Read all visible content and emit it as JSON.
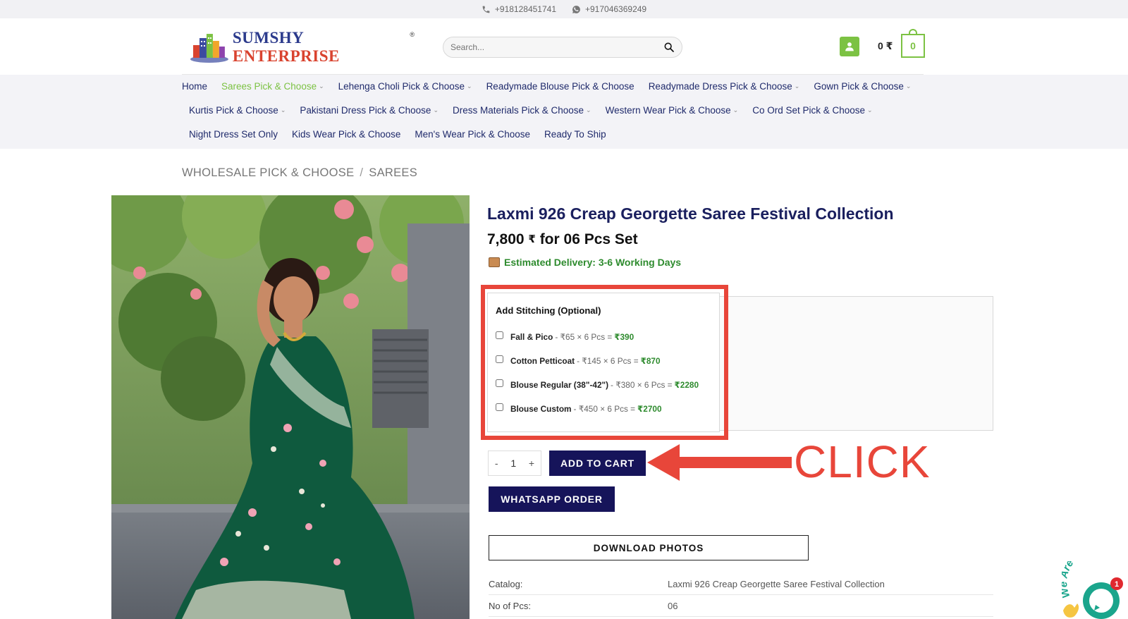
{
  "topbar": {
    "phone": "+918128451741",
    "whatsapp": "+917046369249"
  },
  "header": {
    "logo_part1": "SUMSHY",
    "logo_part2": "ENTERPRISE",
    "logo_reg": "®",
    "search_placeholder": "Search...",
    "cart_total": "0 ₹",
    "cart_count": "0"
  },
  "nav": {
    "row1": [
      {
        "label": "Home",
        "dropdown": false,
        "active": false
      },
      {
        "label": "Sarees Pick & Choose",
        "dropdown": true,
        "active": true
      },
      {
        "label": "Lehenga Choli Pick & Choose",
        "dropdown": true,
        "active": false
      },
      {
        "label": "Readymade Blouse Pick & Choose",
        "dropdown": false,
        "active": false
      },
      {
        "label": "Readymade Dress Pick & Choose",
        "dropdown": true,
        "active": false
      },
      {
        "label": "Gown Pick & Choose",
        "dropdown": true,
        "active": false
      }
    ],
    "row2": [
      {
        "label": "Kurtis Pick & Choose",
        "dropdown": true
      },
      {
        "label": "Pakistani Dress Pick & Choose",
        "dropdown": true
      },
      {
        "label": "Dress Materials Pick & Choose",
        "dropdown": true
      },
      {
        "label": "Western Wear Pick & Choose",
        "dropdown": true
      },
      {
        "label": "Co Ord Set Pick & Choose",
        "dropdown": true
      }
    ],
    "row3": [
      {
        "label": "Night Dress Set Only",
        "dropdown": false
      },
      {
        "label": "Kids Wear Pick & Choose",
        "dropdown": false
      },
      {
        "label": "Men's Wear Pick & Choose",
        "dropdown": false
      },
      {
        "label": "Ready To Ship",
        "dropdown": false
      }
    ]
  },
  "breadcrumb": {
    "level1": "WHOLESALE PICK & CHOOSE",
    "sep": "/",
    "level2": "SAREES"
  },
  "product": {
    "title": "Laxmi 926 Creap Georgette Saree Festival Collection",
    "price_amount": "7,800",
    "price_currency": "₹",
    "price_suffix": "for 06 Pcs Set",
    "delivery": "Estimated Delivery: 3-6 Working Days"
  },
  "stitching": {
    "heading": "Add Stitching (Optional)",
    "options": [
      {
        "name": "Fall & Pico",
        "calc": "- ₹65 × 6 Pcs =",
        "total": "₹390",
        "checked": false
      },
      {
        "name": "Cotton Petticoat",
        "calc": "- ₹145 × 6 Pcs =",
        "total": "₹870",
        "checked": false
      },
      {
        "name": "Blouse Regular (38\"-42\")",
        "calc": "- ₹380 × 6 Pcs =",
        "total": "₹2280",
        "checked": false
      },
      {
        "name": "Blouse Custom",
        "calc": "- ₹450 × 6 Pcs =",
        "total": "₹2700",
        "checked": false
      }
    ]
  },
  "cart": {
    "minus": "-",
    "qty": "1",
    "plus": "+",
    "add_to_cart": "ADD TO CART",
    "whatsapp_order": "WHATSAPP ORDER",
    "download_photos": "DOWNLOAD PHOTOS"
  },
  "annotation": {
    "text": "CLICK",
    "color": "#e8463a"
  },
  "specs": [
    {
      "key": "Catalog:",
      "value": "Laxmi 926 Creap Georgette Saree Festival Collection"
    },
    {
      "key": "No of Pcs:",
      "value": "06"
    }
  ],
  "chat_widget": {
    "text": "We Are Here",
    "badge": "1"
  },
  "colors": {
    "accent_green": "#7cc243",
    "navy": "#16145a",
    "title_navy": "#1a1f5e",
    "annotation_red": "#e8463a",
    "delivery_green": "#2e8b2e"
  }
}
